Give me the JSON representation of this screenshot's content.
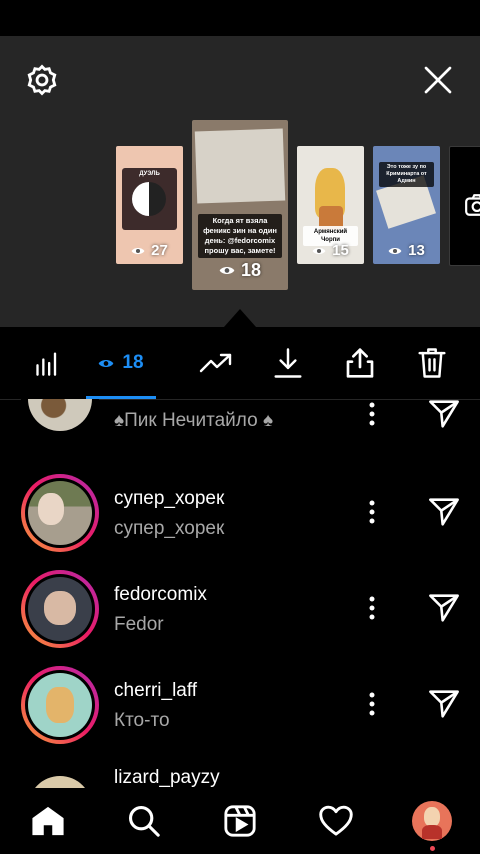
{
  "thumbnails": [
    {
      "views": "27",
      "label": "ДУЭЛЬ"
    },
    {
      "views": "18",
      "caption": "Когда ят взяла феникс зин на один день: @fedorcomix прошу вас, заметe!"
    },
    {
      "views": "15",
      "caption": "Армянский Чорпи"
    },
    {
      "views": "13",
      "caption": "Это тоже зу по Криминарта от Админ"
    }
  ],
  "toolbar": {
    "viewers_count": "18"
  },
  "viewers": [
    {
      "username": "",
      "full_name": "♠Пик Нечитайло ♠"
    },
    {
      "username": "супер_хорек",
      "full_name": "супер_хорек"
    },
    {
      "username": "fedorcomix",
      "full_name": "Fedor"
    },
    {
      "username": "cherri_laff",
      "full_name": "Кто-то"
    },
    {
      "username": "lizard_payzy",
      "full_name": ""
    }
  ],
  "icons": {
    "settings": "gear-icon",
    "close": "close-icon",
    "insights": "bar-chart-icon",
    "views": "eye-icon",
    "promote": "trending-up-icon",
    "download": "download-icon",
    "share": "share-icon",
    "delete": "trash-icon",
    "more": "more-vertical-icon",
    "send": "send-icon"
  },
  "colors": {
    "accent": "#1d8ef5",
    "panel": "#262626",
    "secondary_text": "#a8a8a8",
    "notification_dot": "#ed4956"
  }
}
